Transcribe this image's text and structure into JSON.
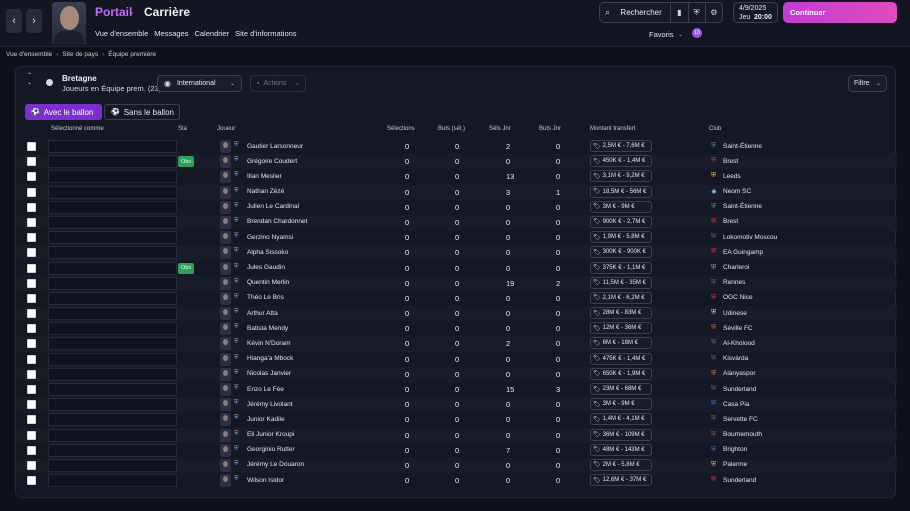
{
  "topbar": {
    "back_icon": "‹",
    "forward_icon": "›",
    "title_portail": "Portail",
    "title_carriere": "Carrière",
    "menu": [
      "Vue d'ensemble",
      "Messages",
      "Calendrier",
      "Site d'informations"
    ],
    "search_label": "Rechercher",
    "date": "4/9/2025",
    "day": "Jeu",
    "time": "20:00",
    "continue_label": "Continuer",
    "favoris_label": "Favoris",
    "favoris_badge": "10"
  },
  "breadcrumb": [
    "Vue d'ensemble",
    "Site de pays",
    "Équipe première"
  ],
  "panel": {
    "team_name": "Bretagne",
    "team_sub": "Joueurs en Équipe prem. (23)",
    "view_dropdown": "International",
    "actions_label": "Actions",
    "filter_label": "Filtre",
    "tab_with_ball": "Avec le ballon",
    "tab_without_ball": "Sans le ballon"
  },
  "table": {
    "headers": {
      "select": "Sélectionné comme",
      "sta": "Sta",
      "player": "Joueur",
      "caps": "Sélections",
      "goals_sel": "Buts (sél.)",
      "caps_jnr": "Séls Jnr",
      "goals_jnr": "Buts Jnr",
      "transfer": "Montant transfert",
      "club": "Club"
    },
    "rows": [
      {
        "name": "Gautier Larsonneur",
        "sta": "",
        "caps": "0",
        "goals": "0",
        "caps_jnr": "2",
        "goals_jnr": "0",
        "value": "2,5M € - 7,6M €",
        "club": "Saint-Étienne",
        "badge": "⛨",
        "color": "#2fa35d"
      },
      {
        "name": "Grégoire Coudert",
        "sta": "Obs",
        "caps": "0",
        "goals": "0",
        "caps_jnr": "0",
        "goals_jnr": "0",
        "value": "450K € - 1,4M €",
        "club": "Brest",
        "badge": "⛨",
        "color": "#d8353a"
      },
      {
        "name": "Illan Meslier",
        "sta": "",
        "caps": "0",
        "goals": "0",
        "caps_jnr": "13",
        "goals_jnr": "0",
        "value": "3,1M € - 9,2M €",
        "club": "Leeds",
        "badge": "⛨",
        "color": "#e7c24a"
      },
      {
        "name": "Nathan Zézé",
        "sta": "",
        "caps": "0",
        "goals": "0",
        "caps_jnr": "3",
        "goals_jnr": "1",
        "value": "18,5M € - 56M €",
        "club": "Neom SC",
        "badge": "✸",
        "color": "#6fb6e8"
      },
      {
        "name": "Julien Le Cardinal",
        "sta": "",
        "caps": "0",
        "goals": "0",
        "caps_jnr": "0",
        "goals_jnr": "0",
        "value": "3M € - 9M €",
        "club": "Saint-Étienne",
        "badge": "⛨",
        "color": "#2fa35d"
      },
      {
        "name": "Brendan Chardonnet",
        "sta": "",
        "caps": "0",
        "goals": "0",
        "caps_jnr": "0",
        "goals_jnr": "0",
        "value": "900K € - 2,7M €",
        "club": "Brest",
        "badge": "⛨",
        "color": "#d8353a"
      },
      {
        "name": "Gerzino Nyamsi",
        "sta": "",
        "caps": "0",
        "goals": "0",
        "caps_jnr": "0",
        "goals_jnr": "0",
        "value": "1,9M € - 5,8M €",
        "club": "Lokomotiv Moscou",
        "badge": "⛨",
        "color": "#d8353a"
      },
      {
        "name": "Alpha Sissoko",
        "sta": "",
        "caps": "0",
        "goals": "0",
        "caps_jnr": "0",
        "goals_jnr": "0",
        "value": "300K € - 900K €",
        "club": "EA Guingamp",
        "badge": "⛨",
        "color": "#d8353a"
      },
      {
        "name": "Jules Gaudin",
        "sta": "Obs",
        "caps": "0",
        "goals": "0",
        "caps_jnr": "0",
        "goals_jnr": "0",
        "value": "375K € - 1,1M €",
        "club": "Charleroi",
        "badge": "⛨",
        "color": "#9aa0ad"
      },
      {
        "name": "Quentin Merlin",
        "sta": "",
        "caps": "0",
        "goals": "0",
        "caps_jnr": "19",
        "goals_jnr": "2",
        "value": "11,5M € - 35M €",
        "club": "Rennes",
        "badge": "⛨",
        "color": "#d8353a"
      },
      {
        "name": "Théo Le Bris",
        "sta": "",
        "caps": "0",
        "goals": "0",
        "caps_jnr": "0",
        "goals_jnr": "0",
        "value": "2,1M € - 6,2M €",
        "club": "OGC Nice",
        "badge": "⛨",
        "color": "#d8353a"
      },
      {
        "name": "Arthur Atta",
        "sta": "",
        "caps": "0",
        "goals": "0",
        "caps_jnr": "0",
        "goals_jnr": "0",
        "value": "28M € - 83M €",
        "club": "Udinese",
        "badge": "⛨",
        "color": "#cfd3dc"
      },
      {
        "name": "Batista Mendy",
        "sta": "",
        "caps": "0",
        "goals": "0",
        "caps_jnr": "0",
        "goals_jnr": "0",
        "value": "12M € - 36M €",
        "club": "Séville FC",
        "badge": "⛨",
        "color": "#e0603a"
      },
      {
        "name": "Kévin N'Doram",
        "sta": "",
        "caps": "0",
        "goals": "0",
        "caps_jnr": "2",
        "goals_jnr": "0",
        "value": "6M € - 18M €",
        "club": "Al-Kholood",
        "badge": "⛨",
        "color": "#d8353a"
      },
      {
        "name": "Hianga'a Mbock",
        "sta": "",
        "caps": "0",
        "goals": "0",
        "caps_jnr": "0",
        "goals_jnr": "0",
        "value": "475K € - 1,4M €",
        "club": "Kisvárda",
        "badge": "⛨",
        "color": "#d8353a"
      },
      {
        "name": "Nicolas Janvier",
        "sta": "",
        "caps": "0",
        "goals": "0",
        "caps_jnr": "0",
        "goals_jnr": "0",
        "value": "650K € - 1,9M €",
        "club": "Alanyaspor",
        "badge": "⛨",
        "color": "#e07c2e"
      },
      {
        "name": "Enzo Le Fée",
        "sta": "",
        "caps": "0",
        "goals": "0",
        "caps_jnr": "15",
        "goals_jnr": "3",
        "value": "23M € - 68M €",
        "club": "Sunderland",
        "badge": "⛨",
        "color": "#d8353a"
      },
      {
        "name": "Jérémy Livolant",
        "sta": "",
        "caps": "0",
        "goals": "0",
        "caps_jnr": "0",
        "goals_jnr": "0",
        "value": "3M € - 9M €",
        "club": "Casa Pia",
        "badge": "⛨",
        "color": "#3b6fd0"
      },
      {
        "name": "Junior Kadile",
        "sta": "",
        "caps": "0",
        "goals": "0",
        "caps_jnr": "0",
        "goals_jnr": "0",
        "value": "1,4M € - 4,1M €",
        "club": "Servette FC",
        "badge": "⛨",
        "color": "#d8353a"
      },
      {
        "name": "Eli Junior Kroupi",
        "sta": "",
        "caps": "0",
        "goals": "0",
        "caps_jnr": "0",
        "goals_jnr": "0",
        "value": "36M € - 109M €",
        "club": "Bournemouth",
        "badge": "⛨",
        "color": "#d8353a"
      },
      {
        "name": "Georginio Rutter",
        "sta": "",
        "caps": "0",
        "goals": "0",
        "caps_jnr": "7",
        "goals_jnr": "0",
        "value": "48M € - 143M €",
        "club": "Brighton",
        "badge": "⛨",
        "color": "#3b6fd0"
      },
      {
        "name": "Jérémy Le Douaron",
        "sta": "",
        "caps": "0",
        "goals": "0",
        "caps_jnr": "0",
        "goals_jnr": "0",
        "value": "2M € - 5,8M €",
        "club": "Palerme",
        "badge": "⛨",
        "color": "#e8a2c4"
      },
      {
        "name": "Wilson Isidor",
        "sta": "",
        "caps": "0",
        "goals": "0",
        "caps_jnr": "0",
        "goals_jnr": "0",
        "value": "12,6M € - 37M €",
        "club": "Sunderland",
        "badge": "⛨",
        "color": "#d8353a"
      }
    ]
  }
}
